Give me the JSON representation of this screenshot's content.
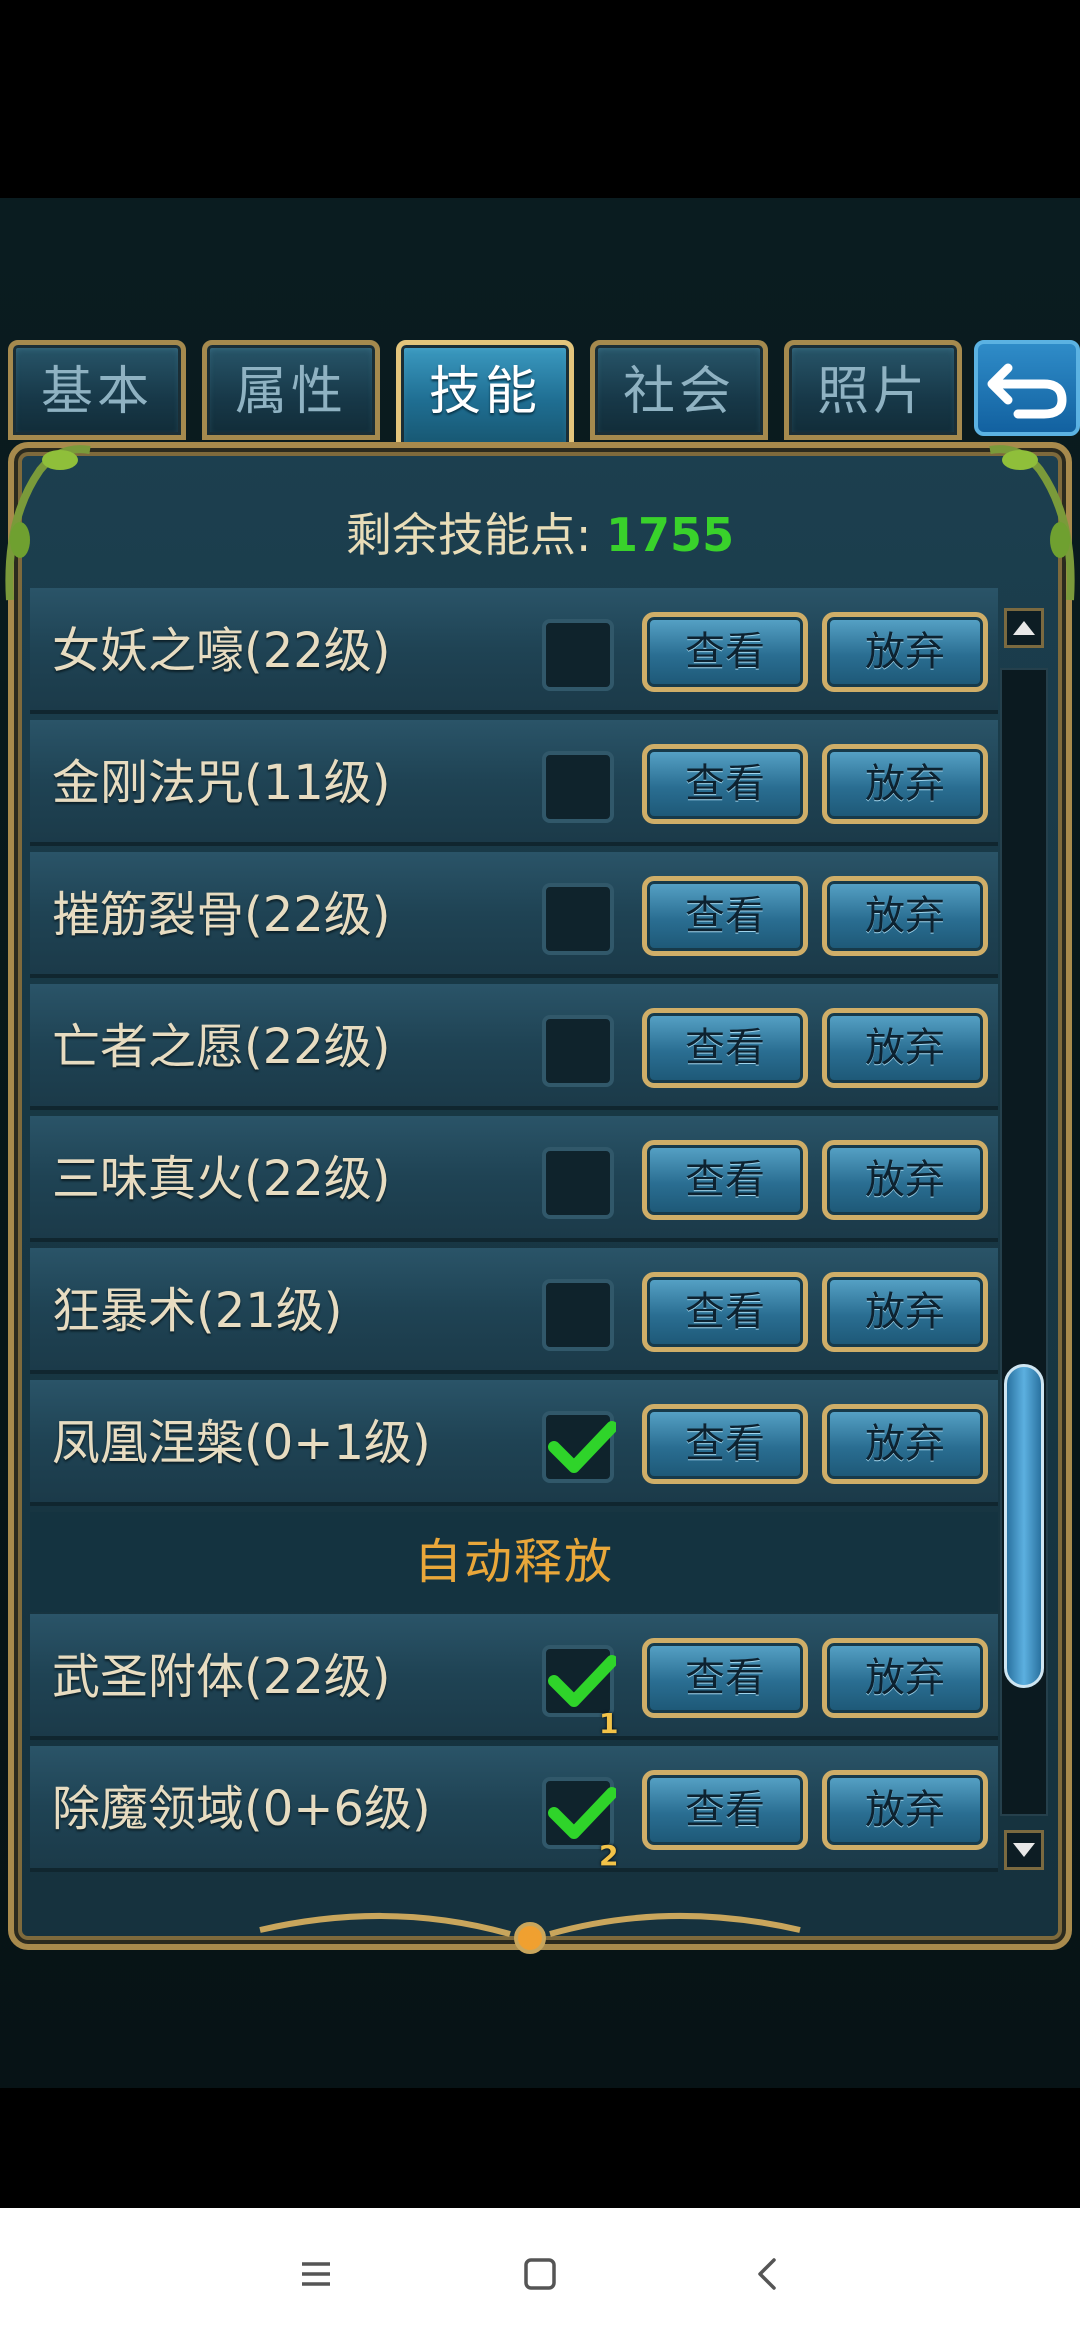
{
  "tabs": [
    {
      "label": "基本",
      "active": false
    },
    {
      "label": "属性",
      "active": false
    },
    {
      "label": "技能",
      "active": true
    },
    {
      "label": "社会",
      "active": false
    },
    {
      "label": "照片",
      "active": false
    }
  ],
  "header": {
    "points_label": "剩余技能点:",
    "points_value": "1755"
  },
  "skills": [
    {
      "name": "女妖之嚎(22级)",
      "checked": false
    },
    {
      "name": "金刚法咒(11级)",
      "checked": false
    },
    {
      "name": "摧筋裂骨(22级)",
      "checked": false
    },
    {
      "name": "亡者之愿(22级)",
      "checked": false
    },
    {
      "name": "三味真火(22级)",
      "checked": false
    },
    {
      "name": "狂暴术(21级)",
      "checked": false
    },
    {
      "name": "凤凰涅槃(0+1级)",
      "checked": true
    }
  ],
  "auto_section": {
    "title": "自动释放",
    "skills": [
      {
        "name": "武圣附体(22级)",
        "checked": true,
        "slot": "1"
      },
      {
        "name": "除魔领域(0+6级)",
        "checked": true,
        "slot": "2"
      }
    ]
  },
  "buttons": {
    "view": "查看",
    "drop": "放弃"
  },
  "colors": {
    "accent_gold": "#cfae68",
    "points_green": "#39d22b",
    "section_orange": "#e9a73a",
    "check_green": "#2fd42a"
  }
}
